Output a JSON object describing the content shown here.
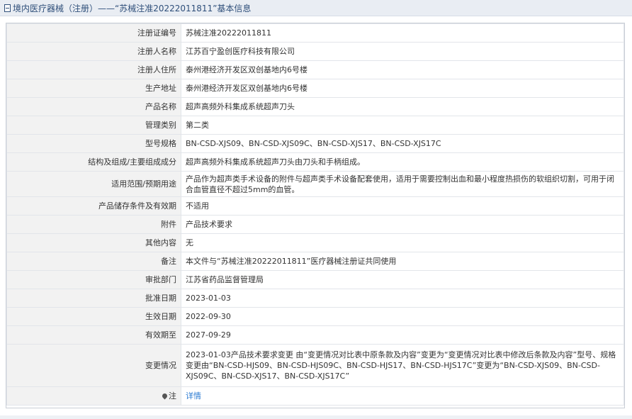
{
  "header": {
    "title": "境内医疗器械（注册）——“苏械注准20222011811”基本信息"
  },
  "rows": [
    {
      "label": "注册证编号",
      "value": "苏械注准20222011811"
    },
    {
      "label": "注册人名称",
      "value": "江苏百宁盈创医疗科技有限公司"
    },
    {
      "label": "注册人住所",
      "value": "泰州港经济开发区双创基地内6号楼"
    },
    {
      "label": "生产地址",
      "value": "泰州港经济开发区双创基地内6号楼"
    },
    {
      "label": "产品名称",
      "value": "超声高频外科集成系统超声刀头"
    },
    {
      "label": "管理类别",
      "value": "第二类"
    },
    {
      "label": "型号规格",
      "value": "BN-CSD-XJS09、BN-CSD-XJS09C、BN-CSD-XJS17、BN-CSD-XJS17C"
    },
    {
      "label": "结构及组成/主要组成成分",
      "value": "超声高频外科集成系统超声刀头由刀头和手柄组成。"
    },
    {
      "label": "适用范围/预期用途",
      "value": "产品作为超声类手术设备的附件与超声类手术设备配套使用，适用于需要控制出血和最小程度热损伤的软组织切割，可用于闭合血管直径不超过5mm的血管。"
    },
    {
      "label": "产品储存条件及有效期",
      "value": "不适用"
    },
    {
      "label": "附件",
      "value": "产品技术要求"
    },
    {
      "label": "其他内容",
      "value": "无"
    },
    {
      "label": "备注",
      "value": "本文件与“苏械注准20222011811”医疗器械注册证共同使用"
    },
    {
      "label": "审批部门",
      "value": "江苏省药品监督管理局"
    },
    {
      "label": "批准日期",
      "value": "2023-01-03"
    },
    {
      "label": "生效日期",
      "value": "2022-09-30"
    },
    {
      "label": "有效期至",
      "value": "2027-09-29"
    },
    {
      "label": "变更情况",
      "value": "2023-01-03产品技术要求变更 由“变更情况对比表中原条款及内容”变更为“变更情况对比表中修改后条款及内容”型号、规格变更由“BN-CSD-HJS09、BN-CSD-HJS09C、BN-CSD-HJS17、BN-CSD-HJS17C”变更为“BN-CSD-XJS09、BN-CSD-XJS09C、BN-CSD-XJS17、BN-CSD-XJS17C”"
    }
  ],
  "note": {
    "label": "注",
    "link_text": "详情",
    "icon": "pin-icon"
  },
  "colors": {
    "header_bg": "#e9edf3",
    "header_text": "#2f4f7a",
    "label_bg": "#f2f2f2",
    "link": "#2a7ad2"
  }
}
